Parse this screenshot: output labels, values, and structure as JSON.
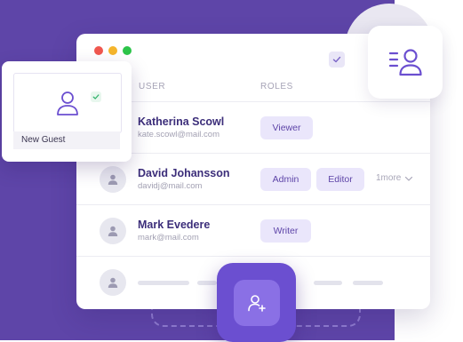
{
  "table": {
    "headers": {
      "user": "USER",
      "roles": "ROLES"
    },
    "rows": [
      {
        "name": "Katherina Scowl",
        "email": "kate.scowl@mail.com",
        "roles": [
          "Viewer"
        ]
      },
      {
        "name": "David Johansson",
        "email": "davidj@mail.com",
        "roles": [
          "Admin",
          "Editor"
        ],
        "more": "1more"
      },
      {
        "name": "Mark Evedere",
        "email": "mark@mail.com",
        "roles": [
          "Writer"
        ]
      }
    ]
  },
  "guest_card": {
    "label": "New Guest"
  },
  "colors": {
    "brand": "#5e45a8",
    "accent": "#6b4fd0",
    "role_chip_bg": "#eae6fb",
    "name_text": "#3c2e7a"
  },
  "icons": {
    "roles_card": "user-list-icon",
    "add_button": "add-user-icon",
    "guest": "user-outline-icon",
    "row_avatar": "user-icon",
    "more": "chevron-down-icon"
  }
}
